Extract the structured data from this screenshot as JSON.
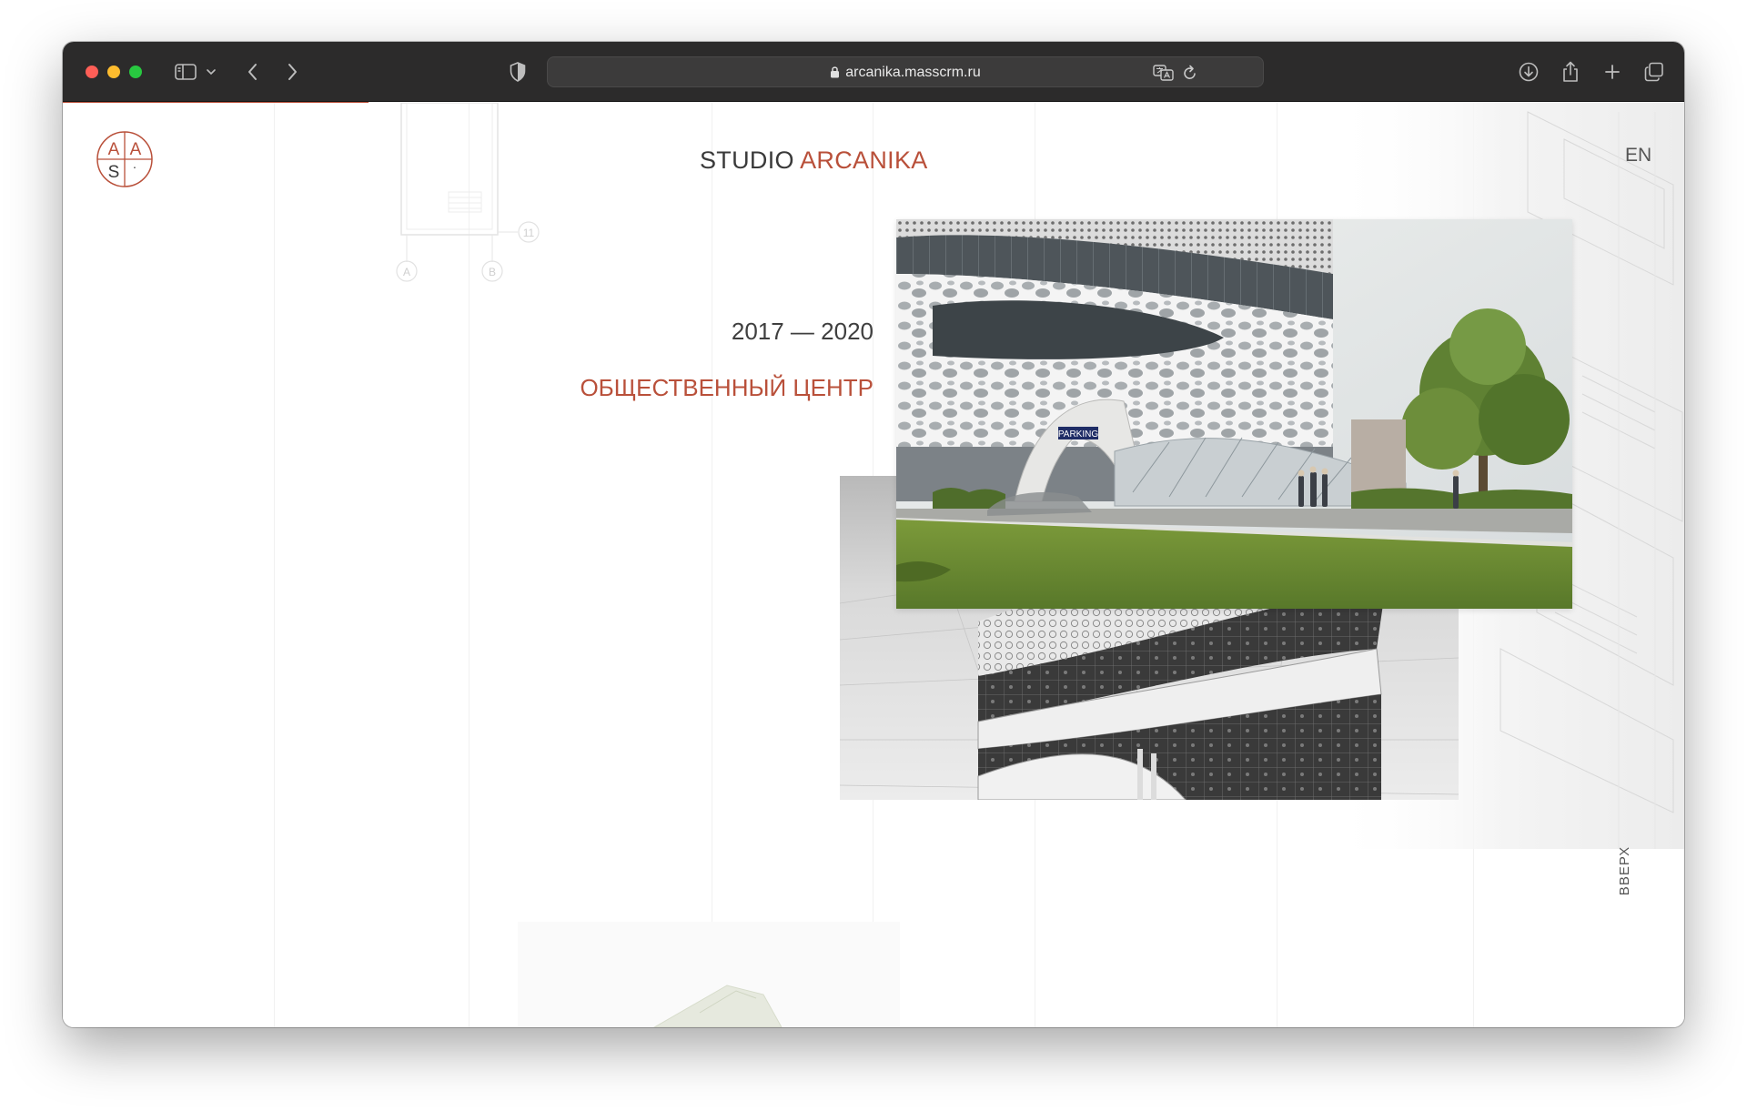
{
  "browser": {
    "url": "arcanika.masscrm.ru",
    "buttons": {
      "sidebar": "sidebar-icon",
      "back": "chevron-left-icon",
      "forward": "chevron-right-icon",
      "shield": "shield-icon",
      "translate": "translate-icon",
      "reload": "reload-icon",
      "downloads": "download-icon",
      "share": "share-icon",
      "new_tab": "plus-icon",
      "tabs": "tabs-icon"
    }
  },
  "site": {
    "logo_letters": [
      "A",
      "A",
      "S",
      "·"
    ],
    "brand_prefix": "STUDIO",
    "brand_name": "ARCANIKA",
    "language": "EN",
    "years": "2017 — 2020",
    "project_title": "ОБЩЕСТВЕННЫЙ ЦЕНТР",
    "to_top": "ВВЕРХ",
    "blueprint_labels": [
      "11",
      "A",
      "B"
    ],
    "parking_sign": "PARKING"
  },
  "colors": {
    "accent": "#b9503a",
    "toolbar": "#2c2b2b",
    "text_dark": "#3f3f3f"
  }
}
